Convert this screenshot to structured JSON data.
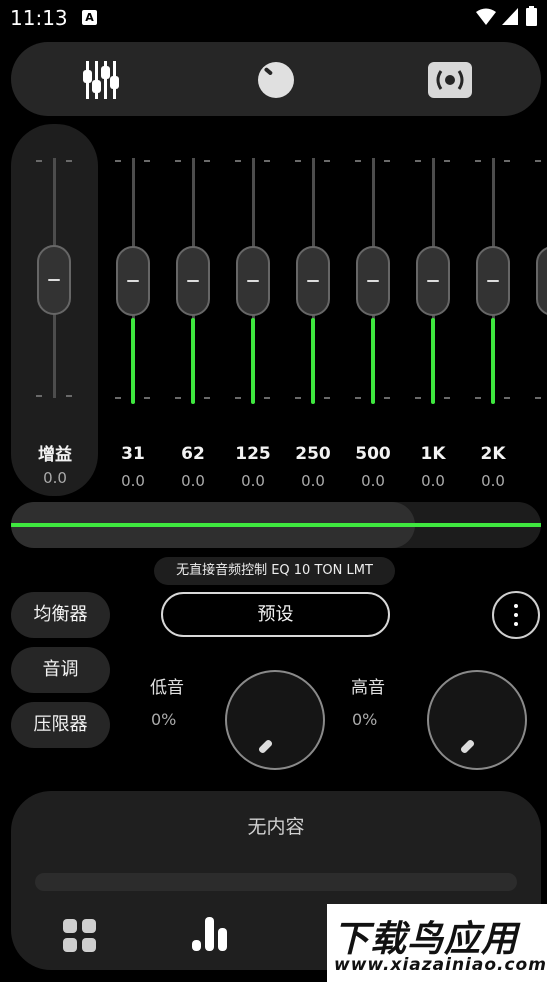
{
  "status": {
    "time": "11:13",
    "notif_badge": "A"
  },
  "tabs": [
    {
      "icon": "equalizer-sliders-icon",
      "active": true
    },
    {
      "icon": "knob-icon",
      "active": false
    },
    {
      "icon": "speaker-surround-icon",
      "active": false
    }
  ],
  "gain": {
    "label": "增益",
    "value": "0.0"
  },
  "bands": [
    {
      "freq": "31",
      "value": "0.0"
    },
    {
      "freq": "62",
      "value": "0.0"
    },
    {
      "freq": "125",
      "value": "0.0"
    },
    {
      "freq": "250",
      "value": "0.0"
    },
    {
      "freq": "500",
      "value": "0.0"
    },
    {
      "freq": "1K",
      "value": "0.0"
    },
    {
      "freq": "2K",
      "value": "0.0"
    }
  ],
  "device_label": "无直接音频控制 EQ 10 TON LMT",
  "side_buttons": {
    "equalizer": "均衡器",
    "tone": "音调",
    "limiter": "压限器"
  },
  "preset_label": "预设",
  "bass": {
    "label": "低音",
    "value": "0%"
  },
  "treble": {
    "label": "高音",
    "value": "0%"
  },
  "now_playing": {
    "text": "无内容"
  },
  "watermark": {
    "main": "下载鸟应用",
    "sub": "www.xiazainiao.com"
  },
  "colors": {
    "accent": "#3fe83f",
    "panel": "#262626",
    "background": "#000000"
  }
}
